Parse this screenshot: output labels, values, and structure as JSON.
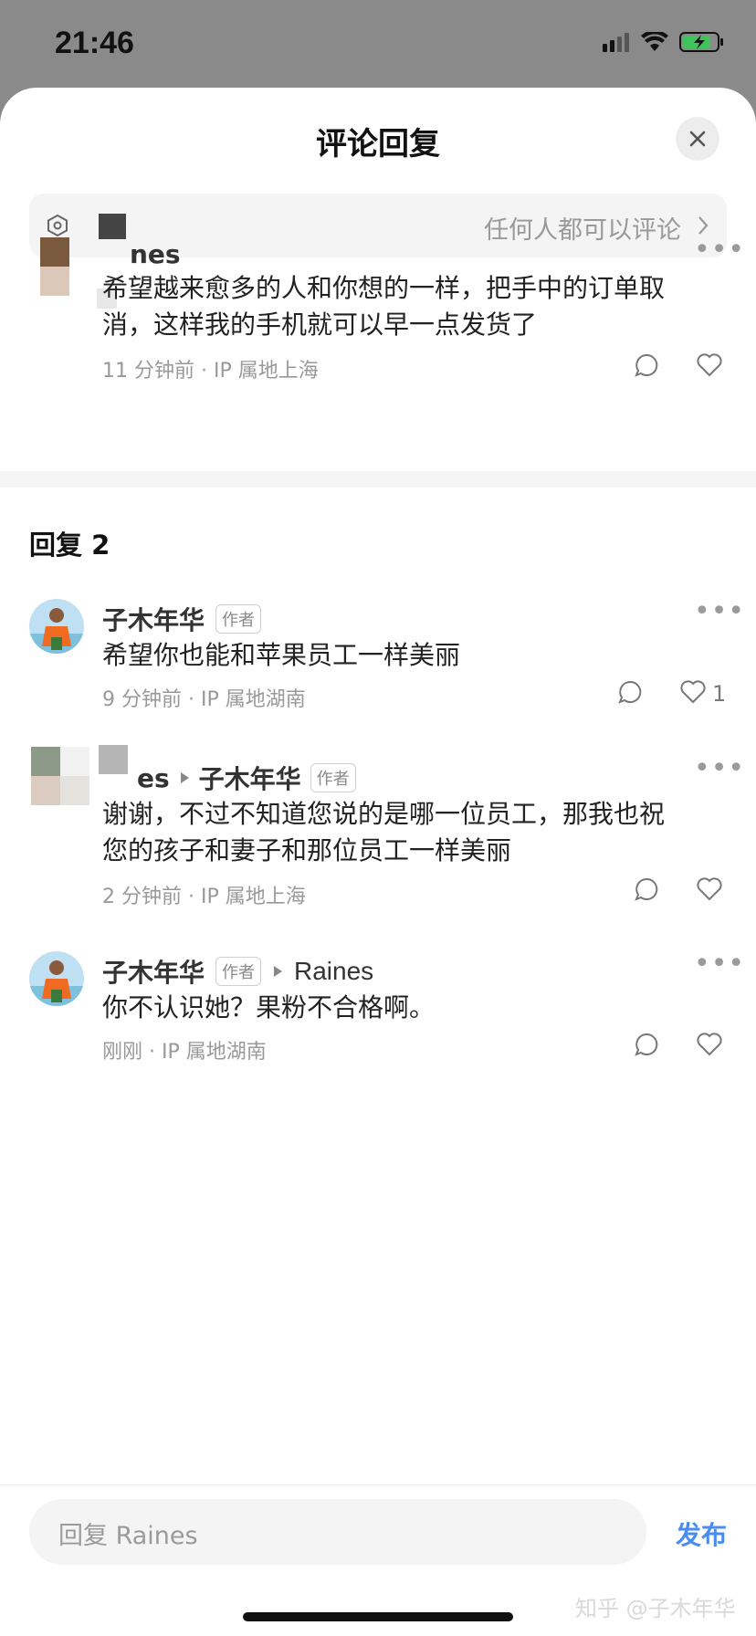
{
  "status_bar": {
    "time": "21:46"
  },
  "sheet": {
    "title": "评论回复",
    "permission": "任何人都可以评论"
  },
  "root_comment": {
    "author": "nes",
    "text_line1": "希望越来愈多的人和你想的一样，把手中的订单取",
    "text_line2": "消，这样我的手机就可以早一点发货了",
    "time": "11 分钟前",
    "location": "IP 属地上海"
  },
  "replies_header": "回复 2",
  "replies": [
    {
      "author": "子木年华",
      "tag": "作者",
      "text": "希望你也能和苹果员工一样美丽",
      "time": "9 分钟前",
      "location": "IP 属地湖南",
      "likes": "1"
    },
    {
      "author": "es",
      "reply_to": "子木年华",
      "reply_to_tag": "作者",
      "text_line1": "谢谢，不过不知道您说的是哪一位员工，那我也祝",
      "text_line2": "您的孩子和妻子和那位员工一样美丽",
      "time": "2 分钟前",
      "location": "IP 属地上海"
    },
    {
      "author": "子木年华",
      "tag": "作者",
      "reply_to": "Raines",
      "text": "你不认识她？果粉不合格啊。",
      "time": "刚刚",
      "location": "IP 属地湖南"
    }
  ],
  "composer": {
    "placeholder": "回复 Raines",
    "publish": "发布"
  },
  "watermark": "知乎 @子木年华",
  "colors": {
    "accent": "#4b8cf0",
    "sheet_bg": "#ffffff",
    "overlay": "#8a8a8a"
  }
}
